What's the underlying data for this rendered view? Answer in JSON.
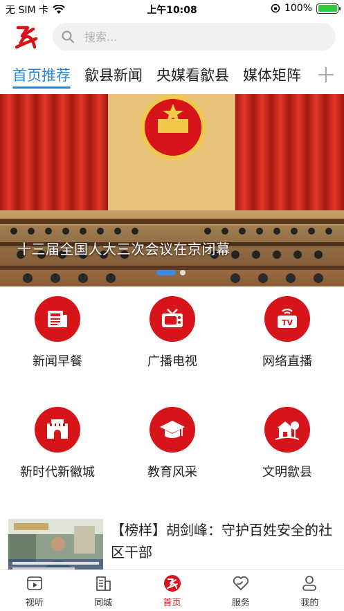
{
  "status": {
    "carrier": "无 SIM 卡",
    "time": "上午10:08",
    "battery": "100%",
    "battery_level": 1.0
  },
  "header": {
    "search_placeholder": "搜索..."
  },
  "tabs": [
    {
      "label": "首页推荐",
      "active": true
    },
    {
      "label": "歙县新闻",
      "active": false
    },
    {
      "label": "央媒看歙县",
      "active": false
    },
    {
      "label": "媒体矩阵",
      "active": false
    }
  ],
  "banner": {
    "caption": "十三届全国人大三次会议在京闭幕",
    "slide_index": 1,
    "slide_count": 2
  },
  "grid": [
    {
      "label": "新闻早餐",
      "icon": "newspaper-icon"
    },
    {
      "label": "广播电视",
      "icon": "retro-tv-icon"
    },
    {
      "label": "网络直播",
      "icon": "live-tv-icon"
    },
    {
      "label": "新时代新徽城",
      "icon": "city-gate-icon"
    },
    {
      "label": "教育风采",
      "icon": "graduation-cap-icon"
    },
    {
      "label": "文明歙县",
      "icon": "house-tree-icon"
    }
  ],
  "news": {
    "title": "【榜样】胡剑峰：守护百姓安全的社区干部"
  },
  "bottom_nav": [
    {
      "label": "视听",
      "icon": "video-icon",
      "active": false
    },
    {
      "label": "同城",
      "icon": "city-building-icon",
      "active": false
    },
    {
      "label": "首页",
      "icon": "home-logo-icon",
      "active": true
    },
    {
      "label": "服务",
      "icon": "heart-hand-icon",
      "active": false
    },
    {
      "label": "我的",
      "icon": "profile-icon",
      "active": false
    }
  ],
  "colors": {
    "accent_red": "#d8141b",
    "tab_active": "#2a87d6"
  }
}
